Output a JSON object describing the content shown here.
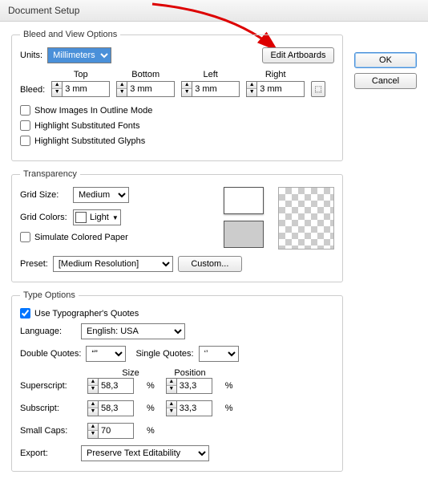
{
  "window": {
    "title": "Document Setup"
  },
  "buttons": {
    "ok": "OK",
    "cancel": "Cancel",
    "editArtboards": "Edit Artboards",
    "custom": "Custom..."
  },
  "bleed": {
    "legend": "Bleed and View Options",
    "unitsLabel": "Units:",
    "unitsValue": "Millimeters",
    "bleedLabel": "Bleed:",
    "top": {
      "label": "Top",
      "value": "3 mm"
    },
    "bottom": {
      "label": "Bottom",
      "value": "3 mm"
    },
    "left": {
      "label": "Left",
      "value": "3 mm"
    },
    "right": {
      "label": "Right",
      "value": "3 mm"
    },
    "cb1": "Show Images In Outline Mode",
    "cb2": "Highlight Substituted Fonts",
    "cb3": "Highlight Substituted Glyphs"
  },
  "transparency": {
    "legend": "Transparency",
    "gridSizeLabel": "Grid Size:",
    "gridSizeValue": "Medium",
    "gridColorsLabel": "Grid Colors:",
    "gridColorsValue": "Light",
    "simulate": "Simulate Colored Paper",
    "presetLabel": "Preset:",
    "presetValue": "[Medium Resolution]"
  },
  "type": {
    "legend": "Type Options",
    "typographers": "Use Typographer's Quotes",
    "languageLabel": "Language:",
    "languageValue": "English: USA",
    "doubleQuotesLabel": "Double Quotes:",
    "doubleQuotesValue": "“”",
    "singleQuotesLabel": "Single Quotes:",
    "singleQuotesValue": "‘’",
    "sizeLabel": "Size",
    "positionLabel": "Position",
    "superscriptLabel": "Superscript:",
    "superscriptSize": "58,3",
    "superscriptPos": "33,3",
    "subscriptLabel": "Subscript:",
    "subscriptSize": "58,3",
    "subscriptPos": "33,3",
    "smallCapsLabel": "Small Caps:",
    "smallCapsValue": "70",
    "exportLabel": "Export:",
    "exportValue": "Preserve Text Editability",
    "pct": "%"
  }
}
